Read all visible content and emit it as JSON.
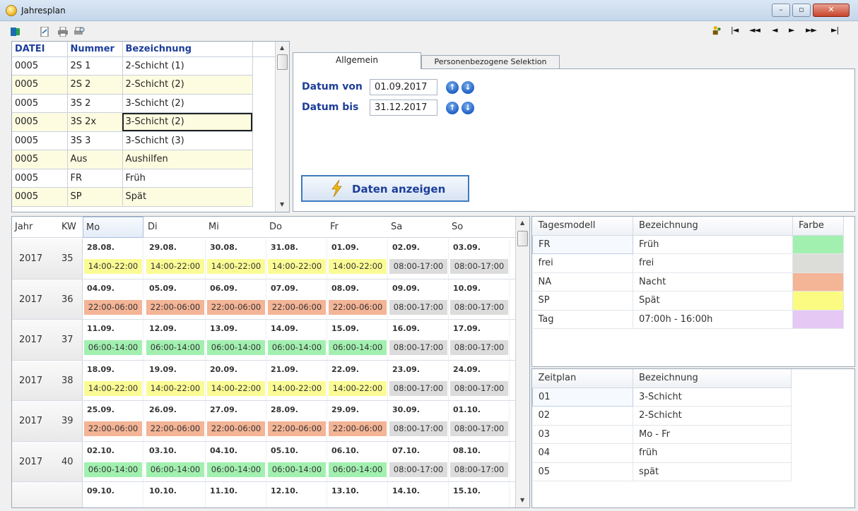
{
  "window": {
    "title": "Jahresplan",
    "buttons": {
      "minimize": "–",
      "maximize": "▫",
      "close": "✕"
    }
  },
  "toolbar": {
    "left_icons": [
      "exit-door-icon",
      "export-doc-icon",
      "print-icon",
      "print-preview-icon"
    ],
    "right_icons": [
      "users-icon"
    ],
    "nav": {
      "first": "|◄",
      "prev_page": "◄◄",
      "prev": "◄",
      "next": "►",
      "next_page": "►►",
      "last": "►|"
    }
  },
  "plan_list": {
    "headers": [
      "DATEI",
      "Nummer",
      "Bezeichnung"
    ],
    "rows": [
      [
        "0005",
        "2S 1",
        "2-Schicht (1)"
      ],
      [
        "0005",
        "2S 2",
        "2-Schicht (2)"
      ],
      [
        "0005",
        "3S 2",
        "3-Schicht (2)"
      ],
      [
        "0005",
        "3S 2x",
        "3-Schicht (2)"
      ],
      [
        "0005",
        "3S 3",
        "3-Schicht (3)"
      ],
      [
        "0005",
        "Aus",
        "Aushilfen"
      ],
      [
        "0005",
        "FR",
        "Früh"
      ],
      [
        "0005",
        "SP",
        "Spät"
      ]
    ],
    "selected_row": 3,
    "colors": {
      "header": "#1d3e9a",
      "alt_row": "#fefce0"
    }
  },
  "tabs": {
    "items": [
      "Allgemein",
      "Personenbezogene Selektion"
    ],
    "active": "Allgemein"
  },
  "filter": {
    "date_from_label": "Datum von",
    "date_from_value": "01.09.2017",
    "date_to_label": "Datum bis",
    "date_to_value": "31.12.2017",
    "show_button": "Daten anzeigen"
  },
  "schedule": {
    "headers": [
      "Jahr",
      "KW",
      "Mo",
      "Di",
      "Mi",
      "Do",
      "Fr",
      "Sa",
      "So"
    ],
    "shift_colors": {
      "14:00-22:00": "#fbfb95",
      "22:00-06:00": "#f4b496",
      "06:00-14:00": "#a2f0b0",
      "08:00-17:00": "#dcdcdc"
    },
    "weeks": [
      {
        "year": "2017",
        "kw": "35",
        "dates": [
          "28.08.",
          "29.08.",
          "30.08.",
          "31.08.",
          "01.09.",
          "02.09.",
          "03.09."
        ],
        "shifts": [
          "14:00-22:00",
          "14:00-22:00",
          "14:00-22:00",
          "14:00-22:00",
          "14:00-22:00",
          "08:00-17:00",
          "08:00-17:00"
        ]
      },
      {
        "year": "2017",
        "kw": "36",
        "dates": [
          "04.09.",
          "05.09.",
          "06.09.",
          "07.09.",
          "08.09.",
          "09.09.",
          "10.09."
        ],
        "shifts": [
          "22:00-06:00",
          "22:00-06:00",
          "22:00-06:00",
          "22:00-06:00",
          "22:00-06:00",
          "08:00-17:00",
          "08:00-17:00"
        ]
      },
      {
        "year": "2017",
        "kw": "37",
        "dates": [
          "11.09.",
          "12.09.",
          "13.09.",
          "14.09.",
          "15.09.",
          "16.09.",
          "17.09."
        ],
        "shifts": [
          "06:00-14:00",
          "06:00-14:00",
          "06:00-14:00",
          "06:00-14:00",
          "06:00-14:00",
          "08:00-17:00",
          "08:00-17:00"
        ]
      },
      {
        "year": "2017",
        "kw": "38",
        "dates": [
          "18.09.",
          "19.09.",
          "20.09.",
          "21.09.",
          "22.09.",
          "23.09.",
          "24.09."
        ],
        "shifts": [
          "14:00-22:00",
          "14:00-22:00",
          "14:00-22:00",
          "14:00-22:00",
          "14:00-22:00",
          "08:00-17:00",
          "08:00-17:00"
        ]
      },
      {
        "year": "2017",
        "kw": "39",
        "dates": [
          "25.09.",
          "26.09.",
          "27.09.",
          "28.09.",
          "29.09.",
          "30.09.",
          "01.10."
        ],
        "shifts": [
          "22:00-06:00",
          "22:00-06:00",
          "22:00-06:00",
          "22:00-06:00",
          "22:00-06:00",
          "08:00-17:00",
          "08:00-17:00"
        ]
      },
      {
        "year": "2017",
        "kw": "40",
        "dates": [
          "02.10.",
          "03.10.",
          "04.10.",
          "05.10.",
          "06.10.",
          "07.10.",
          "08.10."
        ],
        "shifts": [
          "06:00-14:00",
          "06:00-14:00",
          "06:00-14:00",
          "06:00-14:00",
          "06:00-14:00",
          "08:00-17:00",
          "08:00-17:00"
        ]
      },
      {
        "year": "",
        "kw": "",
        "dates": [
          "09.10.",
          "10.10.",
          "11.10.",
          "12.10.",
          "13.10.",
          "14.10.",
          "15.10."
        ],
        "shifts": [
          "",
          "",
          "",
          "",
          "",
          "",
          ""
        ]
      }
    ]
  },
  "day_models": {
    "headers": [
      "Tagesmodell",
      "Bezeichnung",
      "Farbe"
    ],
    "rows": [
      {
        "code": "FR",
        "name": "Früh",
        "color": "#a2f0b0"
      },
      {
        "code": "frei",
        "name": "frei",
        "color": "#dcdcd8"
      },
      {
        "code": "NA",
        "name": "Nacht",
        "color": "#f4b496"
      },
      {
        "code": "SP",
        "name": "Spät",
        "color": "#fbfb82"
      },
      {
        "code": "Tag",
        "name": "07:00h - 16:00h",
        "color": "#e6c8f4"
      }
    ]
  },
  "time_plans": {
    "headers": [
      "Zeitplan",
      "Bezeichnung"
    ],
    "rows": [
      [
        "01",
        "3-Schicht"
      ],
      [
        "02",
        "2-Schicht"
      ],
      [
        "03",
        "Mo - Fr"
      ],
      [
        "04",
        "früh"
      ],
      [
        "05",
        "spät"
      ]
    ]
  }
}
